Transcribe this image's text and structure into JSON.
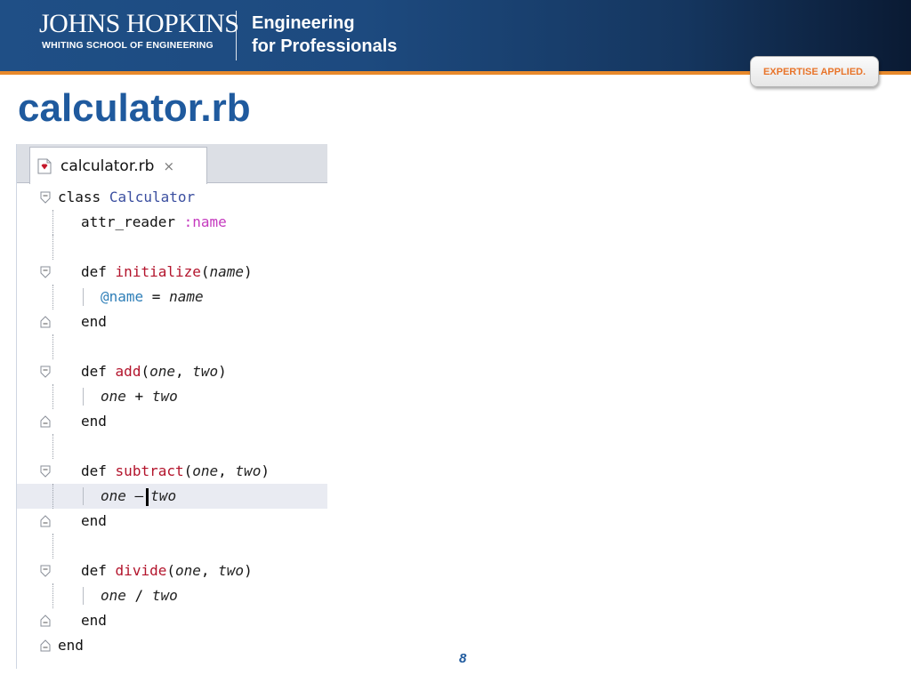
{
  "header": {
    "brand_main": "JOHNS HOPKINS",
    "brand_sub": "WHITING SCHOOL OF ENGINEERING",
    "program_line1": "Engineering",
    "program_line2": "for Professionals",
    "tagline": "EXPERTISE APPLIED.",
    "colors": {
      "banner": "#1f4f86",
      "accent_rule": "#e8892b",
      "tagline_text": "#e8742a"
    }
  },
  "slide": {
    "title": "calculator.rb",
    "page_number": "8",
    "title_color": "#1f5a9e"
  },
  "editor": {
    "tab_label": "calculator.rb",
    "tab_close": "×",
    "file_icon": "ruby-file-icon",
    "code": {
      "l1": {
        "kw": "class",
        "name": "Calculator"
      },
      "l2": {
        "method": "attr_reader",
        "symbol": ":name"
      },
      "l4": {
        "kw": "def",
        "fn": "initialize",
        "open": "(",
        "p1": "name",
        "close": ")"
      },
      "l5": {
        "ivar": "@name",
        "op": " = ",
        "value": "name"
      },
      "l6": {
        "kw": "end"
      },
      "l8": {
        "kw": "def",
        "fn": "add",
        "open": "(",
        "p1": "one",
        "sep": ", ",
        "p2": "two",
        "close": ")"
      },
      "l9": {
        "a": "one",
        "op": " + ",
        "b": "two"
      },
      "l10": {
        "kw": "end"
      },
      "l12": {
        "kw": "def",
        "fn": "subtract",
        "open": "(",
        "p1": "one",
        "sep": ", ",
        "p2": "two",
        "close": ")"
      },
      "l13": {
        "a": "one",
        "op": " –",
        "b": "two"
      },
      "l14": {
        "kw": "end"
      },
      "l16": {
        "kw": "def",
        "fn": "divide",
        "open": "(",
        "p1": "one",
        "sep": ", ",
        "p2": "two",
        "close": ")"
      },
      "l17": {
        "a": "one",
        "op": " / ",
        "b": "two"
      },
      "l18": {
        "kw": "end"
      },
      "l19": {
        "kw": "end"
      }
    },
    "colors": {
      "keyword": "#111111",
      "class_name": "#3b4fa0",
      "symbol": "#c53bbf",
      "method_name": "#b3142c",
      "ivar": "#2f7fb8",
      "current_line": "#e9ebf2"
    }
  }
}
